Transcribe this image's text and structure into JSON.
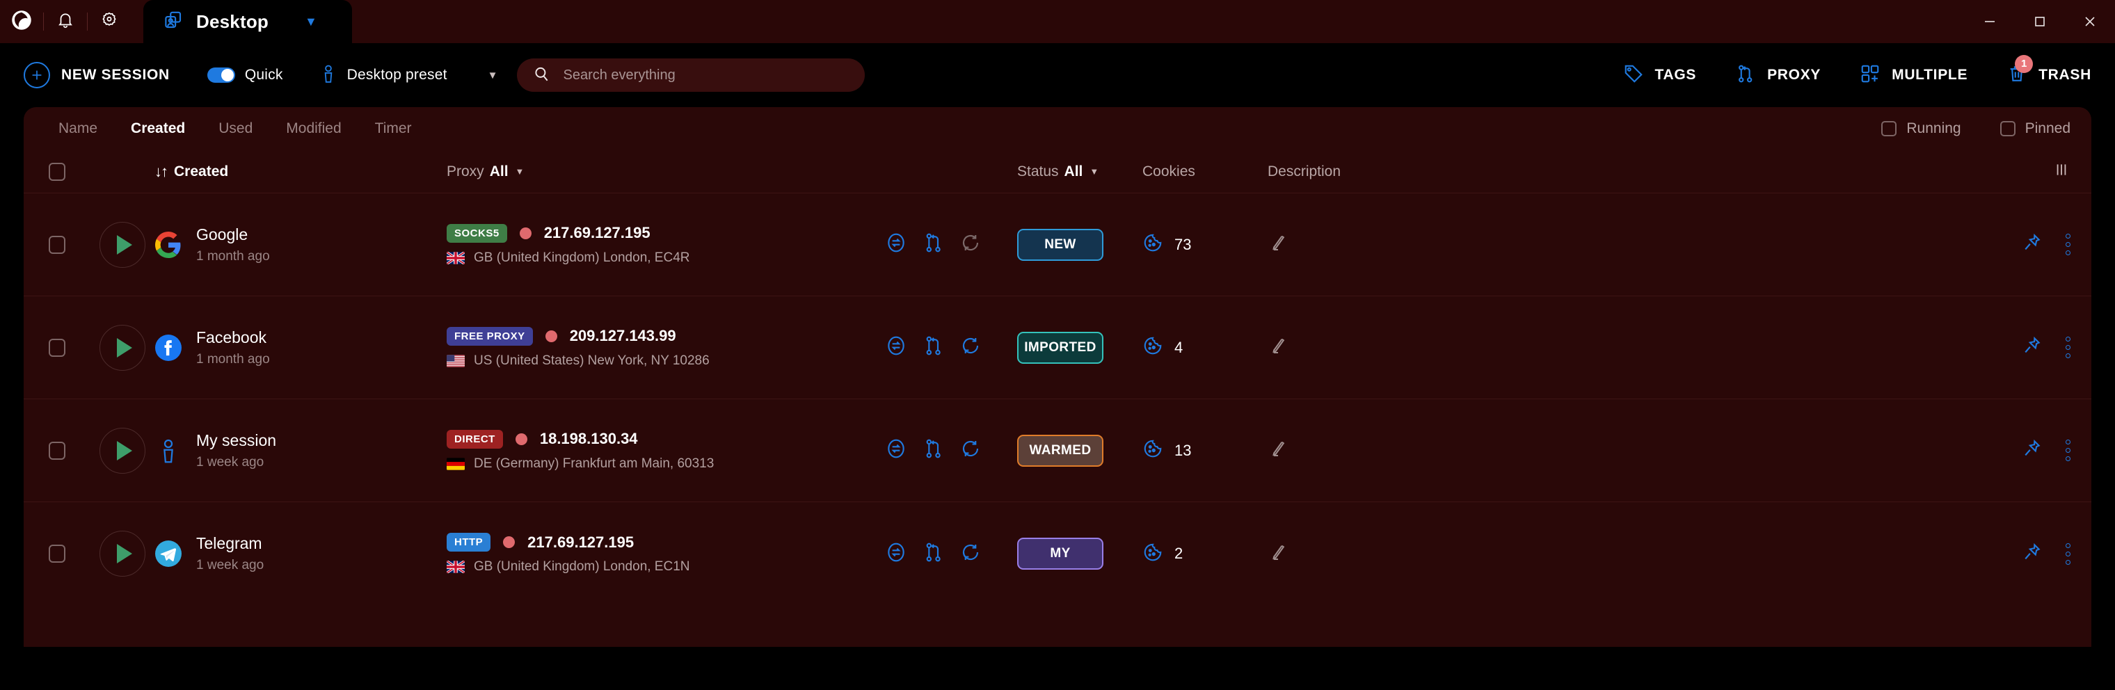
{
  "titlebar": {
    "app_icon": "app-logo-icon",
    "bell_icon": "bell-icon",
    "gear_icon": "gear-icon",
    "tab": {
      "icon": "profiles-icon",
      "label": "Desktop",
      "caret": "▼"
    },
    "window_controls": {
      "minimize": "minimize-icon",
      "maximize": "maximize-icon",
      "close": "close-icon"
    }
  },
  "toolbar": {
    "new_session_label": "NEW SESSION",
    "quick_label": "Quick",
    "quick_enabled": true,
    "preset_label": "Desktop preset",
    "preset_caret": "▼",
    "search_placeholder": "Search everything",
    "search_value": "",
    "tags_label": "TAGS",
    "proxy_label": "PROXY",
    "multiple_label": "MULTIPLE",
    "trash_label": "TRASH",
    "trash_badge": "1"
  },
  "filterbar": {
    "tabs": [
      {
        "label": "Name",
        "active": false
      },
      {
        "label": "Created",
        "active": true
      },
      {
        "label": "Used",
        "active": false
      },
      {
        "label": "Modified",
        "active": false
      },
      {
        "label": "Timer",
        "active": false
      }
    ],
    "running_label": "Running",
    "running_checked": false,
    "pinned_label": "Pinned",
    "pinned_checked": false
  },
  "table": {
    "header": {
      "sort_arrows": "↓↑",
      "created": "Created",
      "proxy_label": "Proxy",
      "proxy_value": "All",
      "status_label": "Status",
      "status_value": "All",
      "cookies": "Cookies",
      "description": "Description",
      "columns_icon": "columns-settings-icon",
      "caret": "▼"
    },
    "rows": [
      {
        "name": "Google",
        "age": "1 month ago",
        "logo": "google-logo-icon",
        "proxy_tag": "SOCKS5",
        "proxy_tag_bg": "#3f7d46",
        "ip": "217.69.127.195",
        "geo": "GB (United Kingdom) London, EC4R",
        "flag": "gb",
        "status": "NEW",
        "status_bg": "#14344f",
        "status_border": "#2f9bd8",
        "cookies": "73",
        "description": ""
      },
      {
        "name": "Facebook",
        "age": "1 month ago",
        "logo": "facebook-logo-icon",
        "proxy_tag": "FREE PROXY",
        "proxy_tag_bg": "#3f3f96",
        "ip": "209.127.143.99",
        "geo": "US (United States) New York, NY 10286",
        "flag": "us",
        "status": "IMPORTED",
        "status_bg": "#0c3b3b",
        "status_border": "#35c2bb",
        "cookies": "4",
        "description": ""
      },
      {
        "name": "My session",
        "age": "1 week ago",
        "logo": "person-icon",
        "proxy_tag": "DIRECT",
        "proxy_tag_bg": "#9e2222",
        "ip": "18.198.130.34",
        "geo": "DE (Germany) Frankfurt am Main, 60313",
        "flag": "de",
        "status": "WARMED",
        "status_bg": "#5c4038",
        "status_border": "#e07c2a",
        "cookies": "13",
        "description": ""
      },
      {
        "name": "Telegram",
        "age": "1 week ago",
        "logo": "telegram-logo-icon",
        "proxy_tag": "HTTP",
        "proxy_tag_bg": "#2a7fd4",
        "ip": "217.69.127.195",
        "geo": "GB (United Kingdom) London, EC1N",
        "flag": "gb",
        "status": "MY",
        "status_bg": "#40306e",
        "status_border": "#9a7fe8",
        "cookies": "2",
        "description": ""
      }
    ],
    "row_icons": {
      "transfer": "transfer-icon",
      "fingerprint": "branch-icon",
      "refresh": "refresh-icon",
      "cookie": "cookie-icon",
      "edit": "pencil-icon",
      "pin": "pin-icon",
      "more": "more-vertical-icon"
    }
  },
  "colors": {
    "accent_blue": "#1f7ae0",
    "panel_bg": "#2a0808",
    "titlebar_bg": "#2a0707",
    "page_bg": "#000000",
    "play_green": "#3e9e6a",
    "badge_red": "#e9767a"
  }
}
